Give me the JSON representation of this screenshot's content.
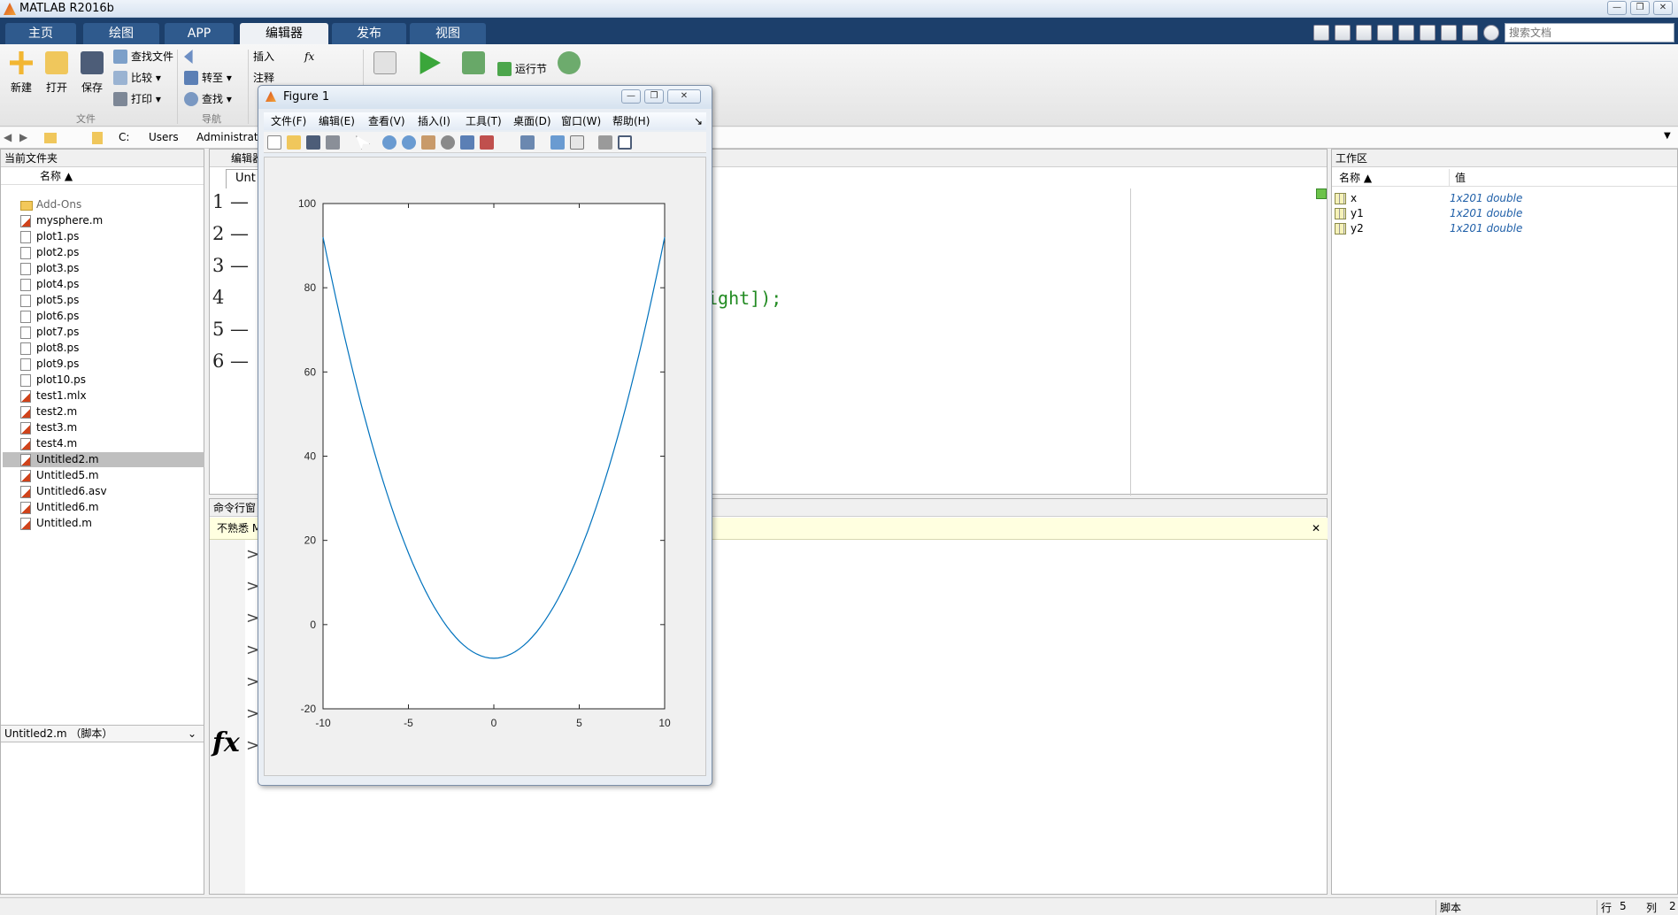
{
  "window": {
    "title": "MATLAB R2016b",
    "btn_min": "—",
    "btn_max": "❐",
    "btn_close": "✕"
  },
  "ribbon_tabs": [
    "主页",
    "绘图",
    "APP",
    "编辑器",
    "发布",
    "视图"
  ],
  "search": {
    "placeholder": "搜索文档"
  },
  "ribbon": {
    "new": "新建",
    "open": "打开",
    "save": "保存",
    "find_files": "查找文件",
    "compare": "比较",
    "print": "打印",
    "goto": "转至",
    "find": "查找",
    "insert": "插入",
    "fx": "fx",
    "comment": "注释",
    "run_section": "运行节",
    "group_file": "文件",
    "group_nav": "导航"
  },
  "address": {
    "crumbs": [
      "C:",
      "Users",
      "Administrat"
    ]
  },
  "current_folder": {
    "title": "当前文件夹",
    "col_name": "名称 ▲",
    "files": [
      {
        "name": "Add-Ons",
        "type": "folder"
      },
      {
        "name": "mysphere.m",
        "type": "m"
      },
      {
        "name": "plot1.ps",
        "type": "ps"
      },
      {
        "name": "plot2.ps",
        "type": "ps"
      },
      {
        "name": "plot3.ps",
        "type": "ps"
      },
      {
        "name": "plot4.ps",
        "type": "ps"
      },
      {
        "name": "plot5.ps",
        "type": "ps"
      },
      {
        "name": "plot6.ps",
        "type": "ps"
      },
      {
        "name": "plot7.ps",
        "type": "ps"
      },
      {
        "name": "plot8.ps",
        "type": "ps"
      },
      {
        "name": "plot9.ps",
        "type": "ps"
      },
      {
        "name": "plot10.ps",
        "type": "ps"
      },
      {
        "name": "test1.mlx",
        "type": "m"
      },
      {
        "name": "test2.m",
        "type": "m"
      },
      {
        "name": "test3.m",
        "type": "m"
      },
      {
        "name": "test4.m",
        "type": "m"
      },
      {
        "name": "Untitled2.m",
        "type": "m",
        "selected": true
      },
      {
        "name": "Untitled5.m",
        "type": "m"
      },
      {
        "name": "Untitled6.asv",
        "type": "m"
      },
      {
        "name": "Untitled6.m",
        "type": "m"
      },
      {
        "name": "Untitled.m",
        "type": "m"
      }
    ],
    "details": "Untitled2.m （脚本）"
  },
  "editor": {
    "title": "编辑器",
    "tab": "Unt",
    "line_numbers": [
      "1 —",
      "2 —",
      "3 —",
      "4",
      "5 —",
      "6 —"
    ],
    "visible_code": "ight]);"
  },
  "command_window": {
    "title": "命令行窗",
    "banner": "不熟悉 M",
    "prompts": [
      ">",
      ">",
      ">",
      ">",
      ">",
      ">",
      ">"
    ],
    "fx": "fx"
  },
  "workspace": {
    "title": "工作区",
    "col_name": "名称 ▲",
    "col_value": "值",
    "vars": [
      {
        "name": "x",
        "value": "1x201 double"
      },
      {
        "name": "y1",
        "value": "1x201 double"
      },
      {
        "name": "y2",
        "value": "1x201 double"
      }
    ]
  },
  "figure": {
    "title": "Figure 1",
    "menu": [
      "文件(F)",
      "编辑(E)",
      "查看(V)",
      "插入(I)",
      "工具(T)",
      "桌面(D)",
      "窗口(W)",
      "帮助(H)"
    ]
  },
  "statusbar": {
    "mode": "脚本",
    "row_label": "行",
    "row": "5",
    "col_label": "列",
    "col": "2"
  },
  "chart_data": {
    "type": "line",
    "title": "",
    "xlabel": "",
    "ylabel": "",
    "xlim": [
      -10,
      10
    ],
    "ylim": [
      -20,
      100
    ],
    "xticks": [
      "-10",
      "-5",
      "0",
      "5",
      "10"
    ],
    "yticks": [
      "100",
      "80",
      "60",
      "40",
      "20",
      "0",
      "-20"
    ],
    "series": [
      {
        "color": "#0072bd",
        "x": [
          -10,
          -8,
          -6,
          -4,
          -2,
          0,
          2,
          4,
          6,
          8,
          10
        ],
        "y": [
          92,
          56.8,
          28,
          5.6,
          -2.4,
          -8,
          -2.4,
          5.6,
          28,
          56.8,
          92
        ]
      }
    ],
    "grid": false
  }
}
